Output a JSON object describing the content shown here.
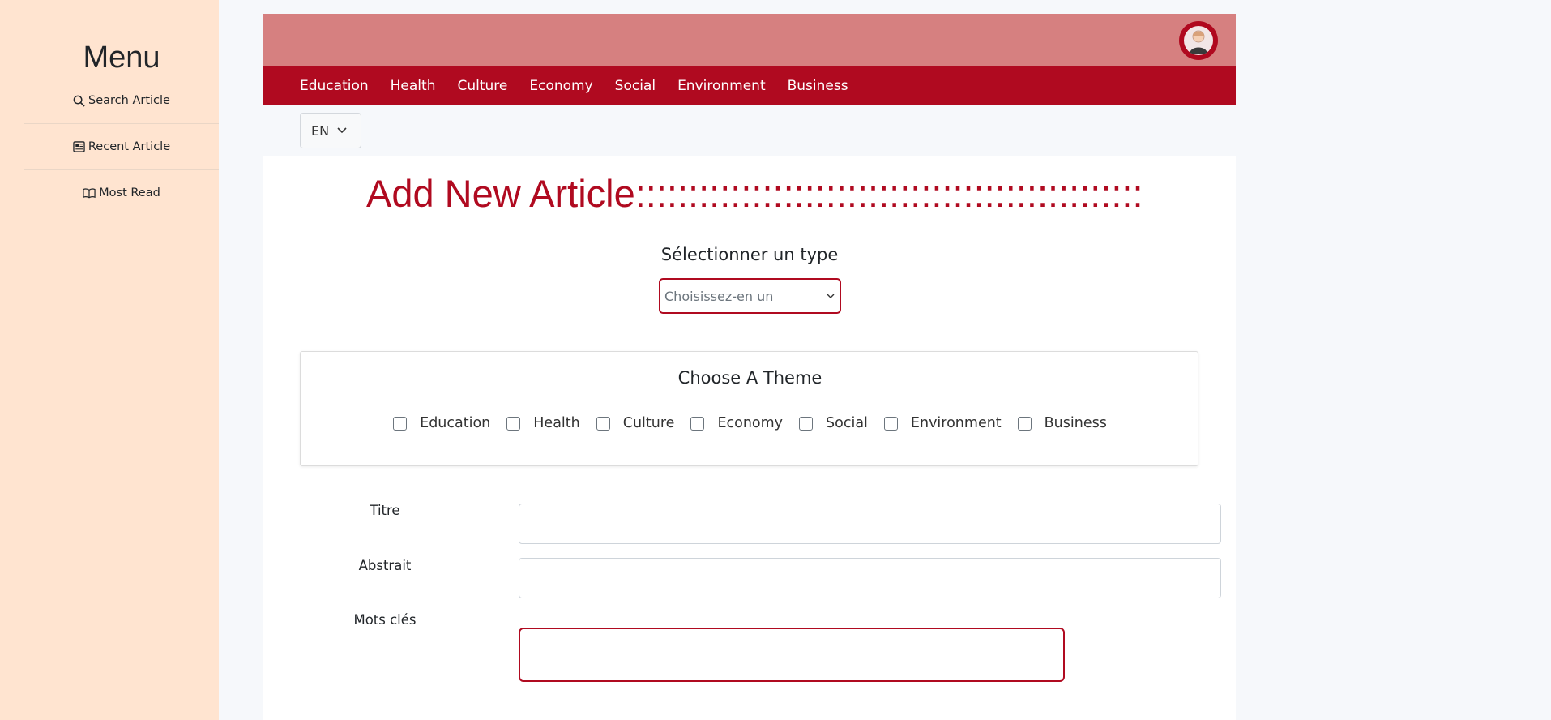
{
  "sidebar": {
    "title": "Menu",
    "items": [
      {
        "label": "Search Article",
        "icon": "search-icon"
      },
      {
        "label": "Recent Article",
        "icon": "newspaper-icon"
      },
      {
        "label": "Most Read",
        "icon": "book-icon"
      }
    ]
  },
  "header": {
    "avatar": "user-avatar",
    "nav": [
      "Education",
      "Health",
      "Culture",
      "Economy",
      "Social",
      "Environment",
      "Business"
    ]
  },
  "language": {
    "selected": "EN"
  },
  "main": {
    "title": "Add New Article::::::::::::::::::::::::::::::::::::::::::::::::",
    "type_label": "Sélectionner un type",
    "type_placeholder": "Choisissez-en un",
    "theme": {
      "title": "Choose A Theme",
      "options": [
        "Education",
        "Health",
        "Culture",
        "Economy",
        "Social",
        "Environment",
        "Business"
      ]
    },
    "form": {
      "title_label": "Titre",
      "abstract_label": "Abstrait",
      "keywords_label": "Mots clés",
      "title_value": "",
      "abstract_value": "",
      "keywords_value": ""
    }
  },
  "colors": {
    "accent": "#b00a20",
    "topbar": "#d68080",
    "sidebar_bg": "#ffe4d0"
  }
}
